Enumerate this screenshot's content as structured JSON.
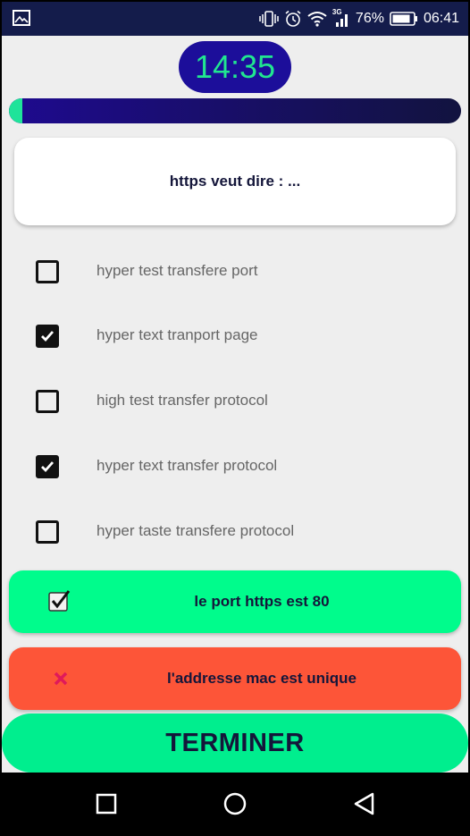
{
  "status_bar": {
    "battery_percent": "76%",
    "time": "06:41",
    "network_label": "3G",
    "icons": [
      "image-icon",
      "vibrate-icon",
      "alarm-icon",
      "wifi-icon",
      "signal-icon",
      "battery-icon"
    ]
  },
  "timer": {
    "value": "14:35"
  },
  "progress": {
    "fraction": 0.03
  },
  "question": {
    "text": "https veut dire : ..."
  },
  "options": [
    {
      "label": "hyper test transfere port",
      "checked": false
    },
    {
      "label": "hyper text tranport page",
      "checked": true
    },
    {
      "label": "high test transfer protocol",
      "checked": false
    },
    {
      "label": "hyper text transfer protocol",
      "checked": true
    },
    {
      "label": "hyper taste transfere protocol",
      "checked": false
    }
  ],
  "feedback": [
    {
      "text": "le port https est 80",
      "status": "correct",
      "icon": "checkbox-check-icon",
      "color": "#00fc8c"
    },
    {
      "text": "l'addresse mac est unique",
      "status": "wrong",
      "icon": "cross-icon",
      "color": "#fd5538"
    }
  ],
  "actions": {
    "finish_label": "TERMINER"
  },
  "colors": {
    "accent_green": "#00ee8e",
    "timer_bg": "#1c0e9a",
    "timer_text": "#21e690",
    "wrong_red": "#fd5538",
    "cross_icon": "#e0195a"
  }
}
